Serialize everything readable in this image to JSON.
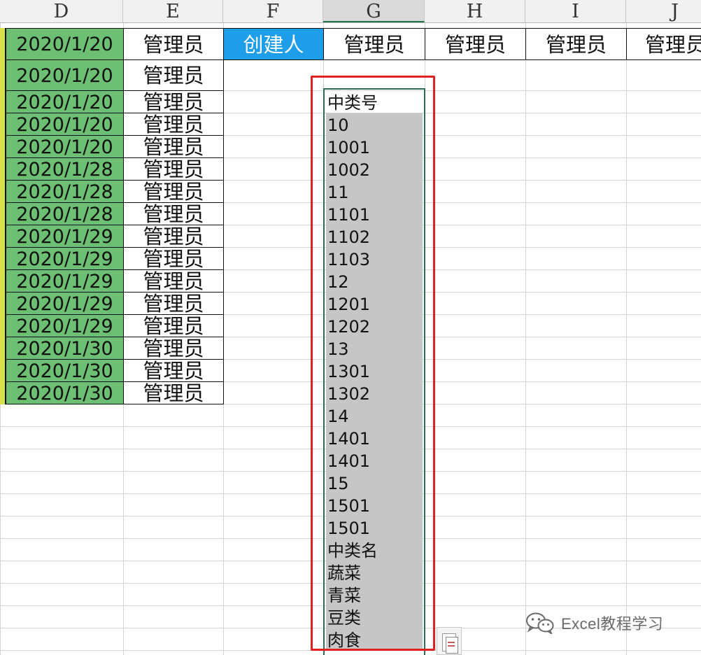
{
  "column_headers": [
    "D",
    "E",
    "F",
    "G",
    "H",
    "I",
    "J"
  ],
  "selected_column": "G",
  "header_row": {
    "date": "2020/1/20",
    "admin": "管理员",
    "creator_label": "创建人",
    "admin_g": "管理员",
    "admin_h": "管理员",
    "admin_i": "管理员",
    "admin_j": "管理员"
  },
  "data_rows": [
    {
      "date": "2020/1/20",
      "admin": "管理员"
    },
    {
      "date": "2020/1/20",
      "admin": "管理员"
    },
    {
      "date": "2020/1/20",
      "admin": "管理员"
    },
    {
      "date": "2020/1/20",
      "admin": "管理员"
    },
    {
      "date": "2020/1/28",
      "admin": "管理员"
    },
    {
      "date": "2020/1/28",
      "admin": "管理员"
    },
    {
      "date": "2020/1/28",
      "admin": "管理员"
    },
    {
      "date": "2020/1/29",
      "admin": "管理员"
    },
    {
      "date": "2020/1/29",
      "admin": "管理员"
    },
    {
      "date": "2020/1/29",
      "admin": "管理员"
    },
    {
      "date": "2020/1/29",
      "admin": "管理员"
    },
    {
      "date": "2020/1/29",
      "admin": "管理员"
    },
    {
      "date": "2020/1/30",
      "admin": "管理员"
    },
    {
      "date": "2020/1/30",
      "admin": "管理员"
    },
    {
      "date": "2020/1/30",
      "admin": "管理员"
    }
  ],
  "pasted_list": [
    "中类号",
    "10",
    "1001",
    "1002",
    "11",
    "1101",
    "1102",
    "1103",
    "12",
    "1201",
    "1202",
    "13",
    "1301",
    "1302",
    "14",
    "1401",
    "1401",
    "15",
    "1501",
    "1501",
    "中类名",
    "蔬菜",
    "青菜",
    "豆类",
    "肉食"
  ],
  "paste_options_icon": "paste-options-icon",
  "watermark": {
    "icon": "wechat-icon",
    "text": "Excel教程学习"
  },
  "colors": {
    "date_fill": "#6dbf73",
    "creator_fill": "#1e9ee8",
    "selection_fill": "#c6c6c6",
    "highlight_border": "#e02020",
    "selection_border": "#2f6e52"
  }
}
